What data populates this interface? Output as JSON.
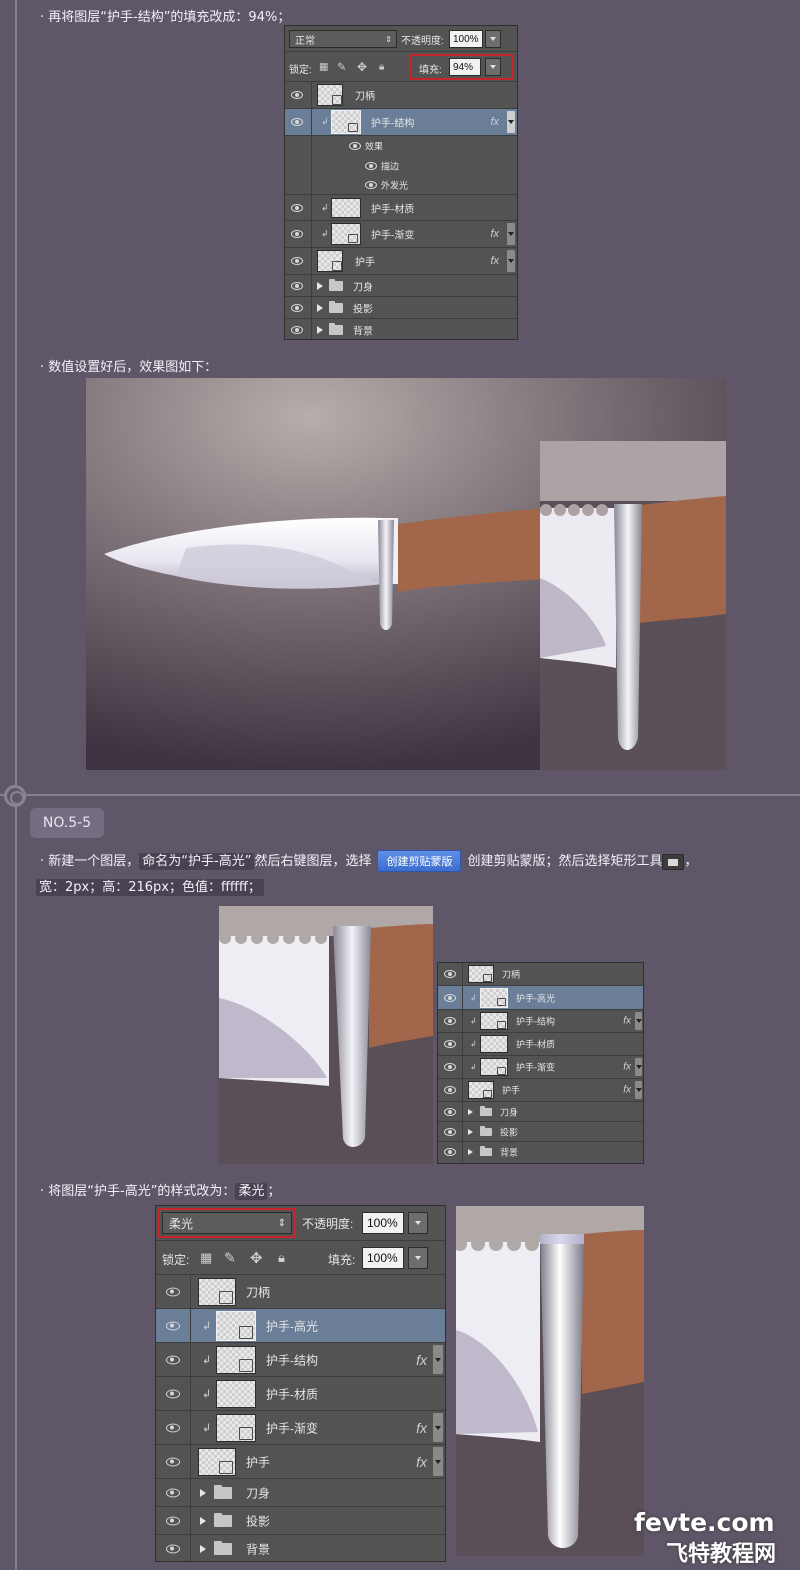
{
  "captions": {
    "step1": "· 再将图层“护手-结构”的填充改成：94%；",
    "step2": "· 数值设置好后，效果图如下：",
    "step3_a": "· 新建一个图层，",
    "step3_b": "命名为“护手-高光”",
    "step3_c": "然后右键图层，选择",
    "step3_button": "创建剪贴蒙版",
    "step3_d": "创建剪贴蒙版；然后选择矩形工具",
    "step3_e": "，",
    "step3_line2": "宽：2px；高：216px；色值：ffffff；",
    "step4_a": "· 将图层“护手-高光”的样式改为：",
    "step4_b": "柔光",
    "step4_c": "；"
  },
  "section_label": "NO.5-5",
  "panel1": {
    "blend_mode": "正常",
    "opacity_label": "不透明度:",
    "opacity_value": "100%",
    "lock_label": "锁定:",
    "fill_label": "填充:",
    "fill_value": "94%",
    "layers": [
      {
        "name": "刀柄",
        "fx": ""
      },
      {
        "name": "护手-结构",
        "fx": "fx"
      },
      {
        "name": "效果",
        "fx": ""
      },
      {
        "name": "描边",
        "fx": ""
      },
      {
        "name": "外发光",
        "fx": ""
      },
      {
        "name": "护手-材质",
        "fx": ""
      },
      {
        "name": "护手-渐变",
        "fx": "fx"
      },
      {
        "name": "护手",
        "fx": "fx"
      },
      {
        "name": "刀身",
        "fx": ""
      },
      {
        "name": "投影",
        "fx": ""
      },
      {
        "name": "背景",
        "fx": ""
      }
    ]
  },
  "panel2": {
    "layers": [
      {
        "name": "刀柄",
        "fx": ""
      },
      {
        "name": "护手-高光",
        "fx": ""
      },
      {
        "name": "护手-结构",
        "fx": "fx"
      },
      {
        "name": "护手-材质",
        "fx": ""
      },
      {
        "name": "护手-渐变",
        "fx": "fx"
      },
      {
        "name": "护手",
        "fx": "fx"
      },
      {
        "name": "刀身",
        "fx": ""
      },
      {
        "name": "投影",
        "fx": ""
      },
      {
        "name": "背景",
        "fx": ""
      }
    ]
  },
  "panel3": {
    "blend_mode": "柔光",
    "opacity_label": "不透明度:",
    "opacity_value": "100%",
    "lock_label": "锁定:",
    "fill_label": "填充:",
    "fill_value": "100%",
    "layers": [
      {
        "name": "刀柄",
        "fx": ""
      },
      {
        "name": "护手-高光",
        "fx": ""
      },
      {
        "name": "护手-结构",
        "fx": "fx"
      },
      {
        "name": "护手-材质",
        "fx": ""
      },
      {
        "name": "护手-渐变",
        "fx": "fx"
      },
      {
        "name": "护手",
        "fx": "fx"
      },
      {
        "name": "刀身",
        "fx": ""
      },
      {
        "name": "投影",
        "fx": ""
      },
      {
        "name": "背景",
        "fx": ""
      }
    ]
  },
  "watermark": {
    "line1": "fevte.com",
    "line2": "飞特教程网"
  },
  "colors": {
    "page_bg": "#5f5768",
    "panel_bg": "#535353",
    "selected_row": "#6b7e97",
    "highlight_red": "#c8252b",
    "handle_brown": "#a2664a"
  }
}
